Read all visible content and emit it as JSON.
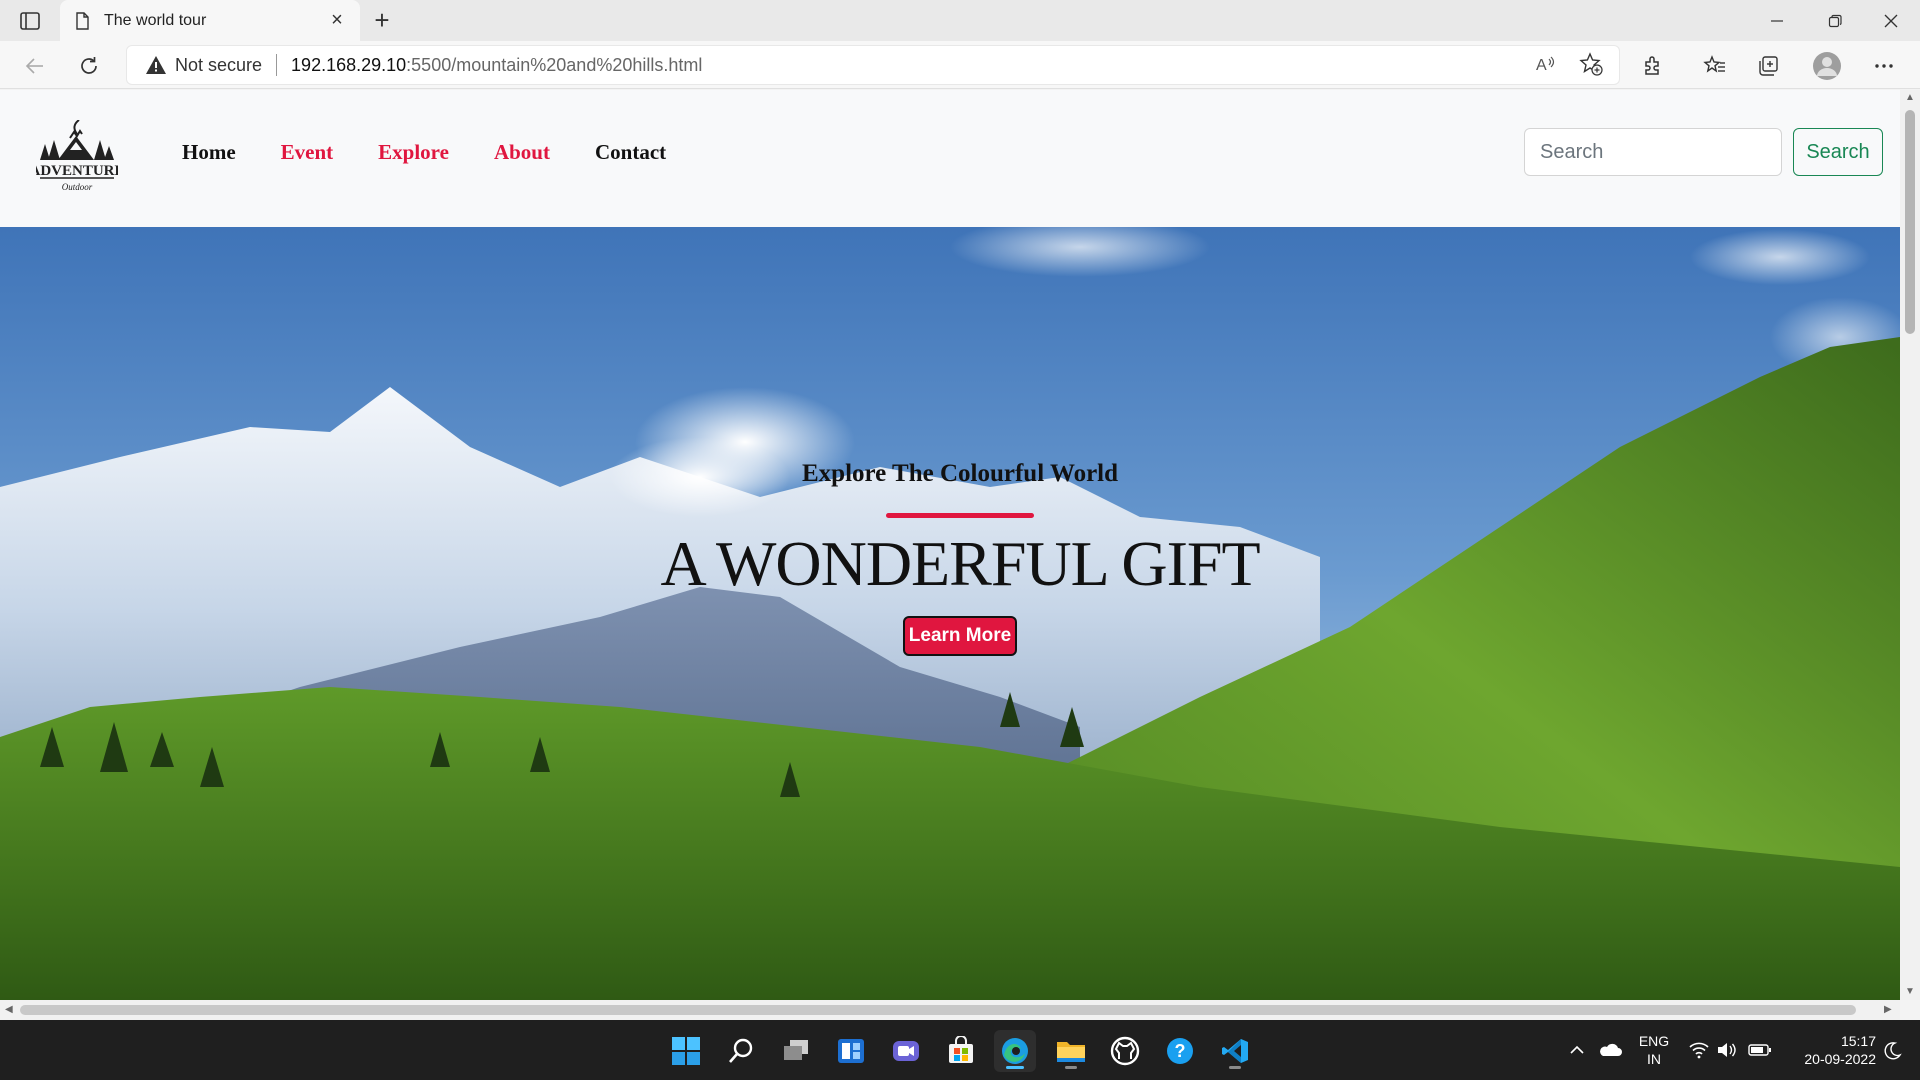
{
  "browser": {
    "tab_title": "The world tour",
    "security_label": "Not secure",
    "url_host": "192.168.29.10",
    "url_path": ":5500/mountain%20and%20hills.html"
  },
  "site": {
    "logo_name": "ADVENTURE",
    "logo_tagline": "Outdoor",
    "nav": {
      "home": "Home",
      "event": "Event",
      "explore": "Explore",
      "about": "About",
      "contact": "Contact"
    },
    "search": {
      "placeholder": "Search",
      "button": "Search"
    },
    "hero": {
      "subtitle": "Explore The Colourful World",
      "title": "A WONDERFUL GIFT",
      "button": "Learn More"
    }
  },
  "taskbar": {
    "lang_line1": "ENG",
    "lang_line2": "IN",
    "time": "15:17",
    "date": "20-09-2022"
  },
  "colors": {
    "accent_red": "#e0163f",
    "search_green": "#198754"
  }
}
